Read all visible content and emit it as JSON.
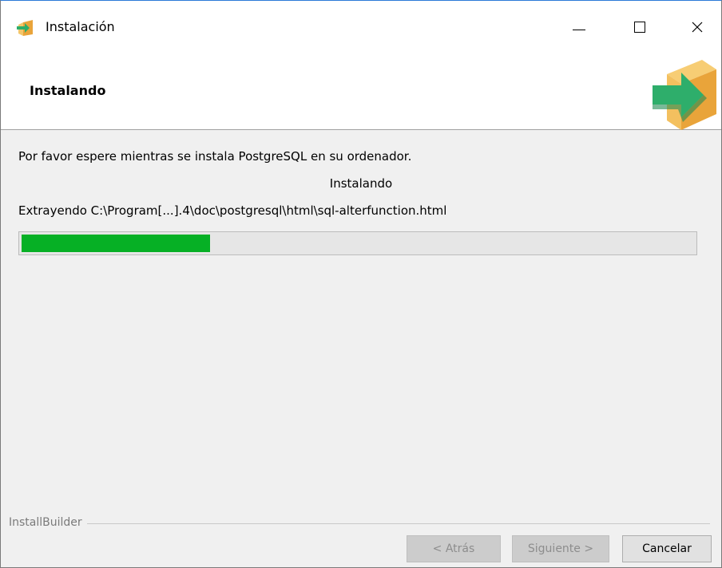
{
  "window": {
    "title": "Instalación",
    "controls": {
      "minimize_icon": "minimize-icon",
      "maximize_icon": "maximize-icon",
      "close_icon": "close-icon"
    }
  },
  "header": {
    "title": "Instalando"
  },
  "body": {
    "message": "Por favor espere mientras se instala PostgreSQL en su ordenador.",
    "status": "Instalando",
    "detail": "Extrayendo C:\\Program[...].4\\doc\\postgresql\\html\\sql-alterfunction.html",
    "progress_fraction": 0.28
  },
  "footer": {
    "brand": "InstallBuilder",
    "buttons": {
      "back": "< Atrás",
      "next": "Siguiente >",
      "cancel": "Cancelar"
    }
  },
  "colors": {
    "progress_fill": "#06b025",
    "titlebar_accent": "#2b79d7"
  }
}
